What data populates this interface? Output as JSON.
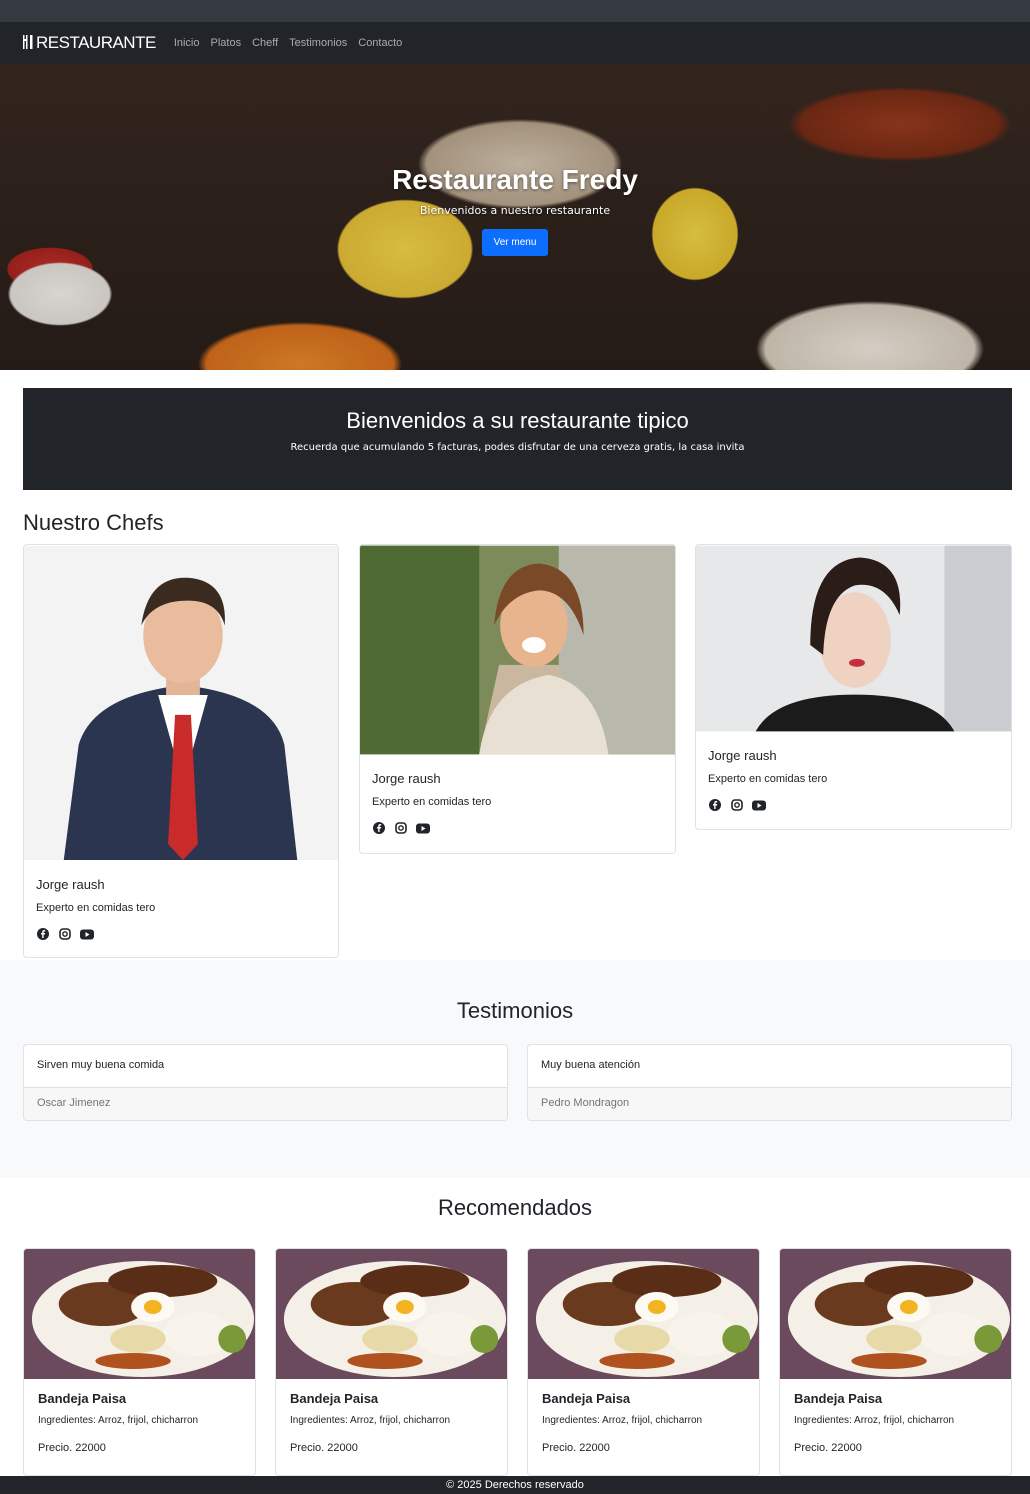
{
  "nav": {
    "brand": "RESTAURANTE",
    "brand_icon": "fork-knife-icon",
    "links": [
      "Inicio",
      "Platos",
      "Cheff",
      "Testimonios",
      "Contacto"
    ]
  },
  "hero": {
    "title": "Restaurante Fredy",
    "subtitle": "Bienvenidos a nuestro restaurante",
    "button": "Ver menu"
  },
  "welcome": {
    "title": "Bienvenidos a su restaurante tipico",
    "text": "Recuerda que acumulando 5 facturas, podes disfrutar de una cerveza gratis, la casa invita"
  },
  "chefs": {
    "title": "Nuestro Chefs",
    "items": [
      {
        "name": "Jorge raush",
        "text": "Experto en comidas tero",
        "icons": [
          "facebook-icon",
          "instagram-icon",
          "youtube-icon"
        ]
      },
      {
        "name": "Jorge raush",
        "text": "Experto en comidas tero",
        "icons": [
          "facebook-icon",
          "instagram-icon",
          "youtube-icon"
        ]
      },
      {
        "name": "Jorge raush",
        "text": "Experto en comidas tero",
        "icons": [
          "facebook-icon",
          "instagram-icon",
          "youtube-icon"
        ]
      }
    ]
  },
  "testimonios": {
    "title": "Testimonios",
    "items": [
      {
        "quote": "Sirven muy buena comida",
        "author": "Oscar Jimenez"
      },
      {
        "quote": "Muy buena atención",
        "author": "Pedro Mondragon"
      }
    ]
  },
  "recomendados": {
    "title": "Recomendados",
    "items": [
      {
        "name": "Bandeja Paisa",
        "ingredients": "Ingredientes: Arroz, frijol, chicharron",
        "price": "Precio. 22000"
      },
      {
        "name": "Bandeja Paisa",
        "ingredients": "Ingredientes: Arroz, frijol, chicharron",
        "price": "Precio. 22000"
      },
      {
        "name": "Bandeja Paisa",
        "ingredients": "Ingredientes: Arroz, frijol, chicharron",
        "price": "Precio. 22000"
      },
      {
        "name": "Bandeja Paisa",
        "ingredients": "Ingredientes: Arroz, frijol, chicharron",
        "price": "Precio. 22000"
      }
    ]
  },
  "footer": {
    "text": "© 2025 Derechos reservado"
  },
  "colors": {
    "dark": "#212529",
    "primary": "#0d6efd",
    "light": "#f8f9fa"
  }
}
